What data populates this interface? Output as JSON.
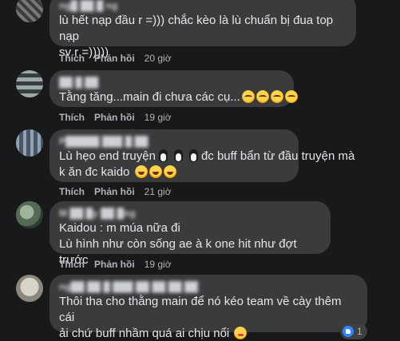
{
  "comments": [
    {
      "name": "ng█ ██ █ ng",
      "lines": [
        "lù hết nạp đầu r =))) chắc kèo là lù chuẩn bị đua top nạp",
        "sv r =)))))"
      ],
      "like": "Thích",
      "reply": "Phản hồi",
      "time": "20 giờ"
    },
    {
      "name": "██ █ ██",
      "lines": [
        "Tằng tăng...main đi chưa các cụ..."
      ],
      "emojis": [
        "crying-laughing",
        "crying-laughing",
        "crying-laughing",
        "crying-laughing"
      ],
      "like": "Thích",
      "reply": "Phản hồi",
      "time": "19 giờ"
    },
    {
      "name": "P█████ ███ █ ██",
      "lines_a": "Lù hẹo end truyện",
      "lines_b": "đc buff bẩn từ đầu truyện mà",
      "line2": "k ăn đc kaido",
      "emojis": [
        "rofl",
        "rofl",
        "rofl"
      ],
      "like": "Thích",
      "reply": "Phản hồi",
      "time": "21 giờ"
    },
    {
      "name": "M ██ █y ██ █ng",
      "lines": [
        "Kaidou : m múa nữa đi",
        "Lù hình như còn sống ae à k one hit như đợt trước"
      ],
      "like": "Thích",
      "reply": "Phản hồi",
      "time": "19 giờ"
    },
    {
      "name": "ng██ ██ █ ███ ██ ██ ██ ██",
      "lines": [
        "Thôi tha cho thằng main để nó kéo team về cày thêm cái",
        "ải chứ buff nhầm quá ai chịu nổi"
      ],
      "emojis": [
        "winking-tongue"
      ],
      "reaction_count": "1"
    }
  ],
  "colors": {
    "background": "#18191a",
    "bubble": "#3a3b3c",
    "text": "#e4e6eb",
    "secondary": "#b0b3b8",
    "like_blue": "#2d88ff"
  }
}
